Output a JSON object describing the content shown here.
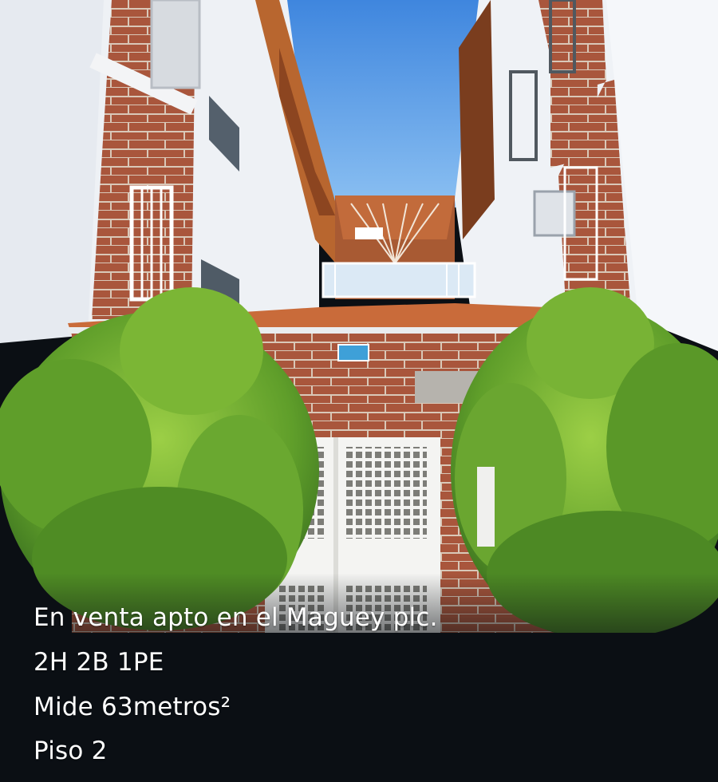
{
  "listing": {
    "lines": [
      "En venta apto en el Maguey plc.",
      "2H 2B 1PE",
      "Mide 63metros²",
      "Piso 2"
    ]
  },
  "colors": {
    "sky": "#4a8fe0",
    "brick": "#a5533a",
    "wall": "#eef1f5",
    "foliage": "#6aa32c",
    "caption_bg": "#0b0f14",
    "caption_text": "#ffffff"
  }
}
